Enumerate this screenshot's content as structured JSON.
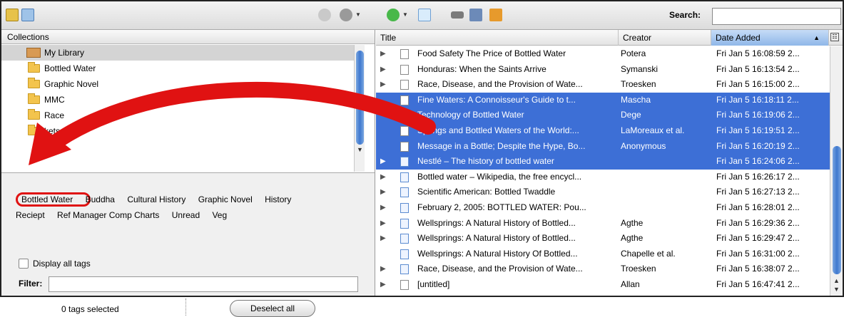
{
  "toolbar": {
    "search_label": "Search:",
    "search_value": ""
  },
  "collections": {
    "header": "Collections",
    "items": [
      {
        "label": "My Library",
        "icon": "library-icon",
        "selected": true
      },
      {
        "label": "Bottled Water",
        "icon": "folder-icon"
      },
      {
        "label": "Graphic Novel",
        "icon": "folder-icon"
      },
      {
        "label": "MMC",
        "icon": "folder-icon"
      },
      {
        "label": "Race",
        "icon": "folder-icon"
      },
      {
        "label": "kets",
        "icon": "folder-icon"
      }
    ]
  },
  "tags": {
    "row1": [
      "Bottled Water",
      "Buddha",
      "Cultural History",
      "Graphic Novel",
      "History"
    ],
    "row2": [
      "Reciept",
      "Ref Manager Comp Charts",
      "Unread",
      "Veg"
    ],
    "display_all_label": "Display all tags",
    "filter_label": "Filter:",
    "filter_value": "",
    "selected_count_text": "0 tags selected",
    "deselect_label": "Deselect all"
  },
  "items": {
    "columns": {
      "title": "Title",
      "creator": "Creator",
      "date": "Date Added"
    },
    "rows": [
      {
        "title": "Food Safety The Price of Bottled Water",
        "creator": "Potera",
        "date": "Fri Jan 5 16:08:59 2...",
        "selected": false,
        "web": false,
        "twisty": true
      },
      {
        "title": "Honduras: When the Saints Arrive",
        "creator": "Symanski",
        "date": "Fri Jan 5 16:13:54 2...",
        "selected": false,
        "web": false,
        "twisty": true
      },
      {
        "title": "Race, Disease, and the Provision of Wate...",
        "creator": "Troesken",
        "date": "Fri Jan 5 16:15:00 2...",
        "selected": false,
        "web": false,
        "twisty": true
      },
      {
        "title": "Fine Waters: A Connoisseur's Guide to t...",
        "creator": "Mascha",
        "date": "Fri Jan 5 16:18:11 2...",
        "selected": true,
        "web": false,
        "twisty": false
      },
      {
        "title": "Technology of Bottled Water",
        "creator": "Dege",
        "date": "Fri Jan 5 16:19:06 2...",
        "selected": true,
        "web": false,
        "twisty": false
      },
      {
        "title": "Springs and Bottled Waters of the World:...",
        "creator": "LaMoreaux et al.",
        "date": "Fri Jan 5 16:19:51 2...",
        "selected": true,
        "web": false,
        "twisty": false
      },
      {
        "title": "Message in a Bottle; Despite the Hype, Bo...",
        "creator": "Anonymous",
        "date": "Fri Jan 5 16:20:19 2...",
        "selected": true,
        "web": false,
        "twisty": false
      },
      {
        "title": "Nestlé – The history of bottled water",
        "creator": "",
        "date": "Fri Jan 5 16:24:06 2...",
        "selected": true,
        "web": true,
        "twisty": true
      },
      {
        "title": "Bottled water – Wikipedia, the free encycl...",
        "creator": "",
        "date": "Fri Jan 5 16:26:17 2...",
        "selected": false,
        "web": true,
        "twisty": true
      },
      {
        "title": "Scientific American: Bottled Twaddle",
        "creator": "",
        "date": "Fri Jan 5 16:27:13 2...",
        "selected": false,
        "web": true,
        "twisty": true
      },
      {
        "title": "February 2, 2005: BOTTLED WATER: Pou...",
        "creator": "",
        "date": "Fri Jan 5 16:28:01 2...",
        "selected": false,
        "web": true,
        "twisty": true
      },
      {
        "title": "Wellsprings: A Natural History of Bottled...",
        "creator": "Agthe",
        "date": "Fri Jan 5 16:29:36 2...",
        "selected": false,
        "web": true,
        "twisty": true
      },
      {
        "title": "Wellsprings: A Natural History of Bottled...",
        "creator": "Agthe",
        "date": "Fri Jan 5 16:29:47 2...",
        "selected": false,
        "web": true,
        "twisty": true
      },
      {
        "title": "Wellsprings: A Natural History Of Bottled...",
        "creator": "Chapelle et al.",
        "date": "Fri Jan 5 16:31:00 2...",
        "selected": false,
        "web": true,
        "twisty": false
      },
      {
        "title": "Race, Disease, and the Provision of Wate...",
        "creator": "Troesken",
        "date": "Fri Jan 5 16:38:07 2...",
        "selected": false,
        "web": true,
        "twisty": true
      },
      {
        "title": "[untitled]",
        "creator": "Allan",
        "date": "Fri Jan 5 16:47:41 2...",
        "selected": false,
        "web": false,
        "twisty": true
      }
    ]
  },
  "colors": {
    "selection": "#3d6fd6",
    "annotation": "#e01212",
    "folder": "#f3c44d"
  }
}
